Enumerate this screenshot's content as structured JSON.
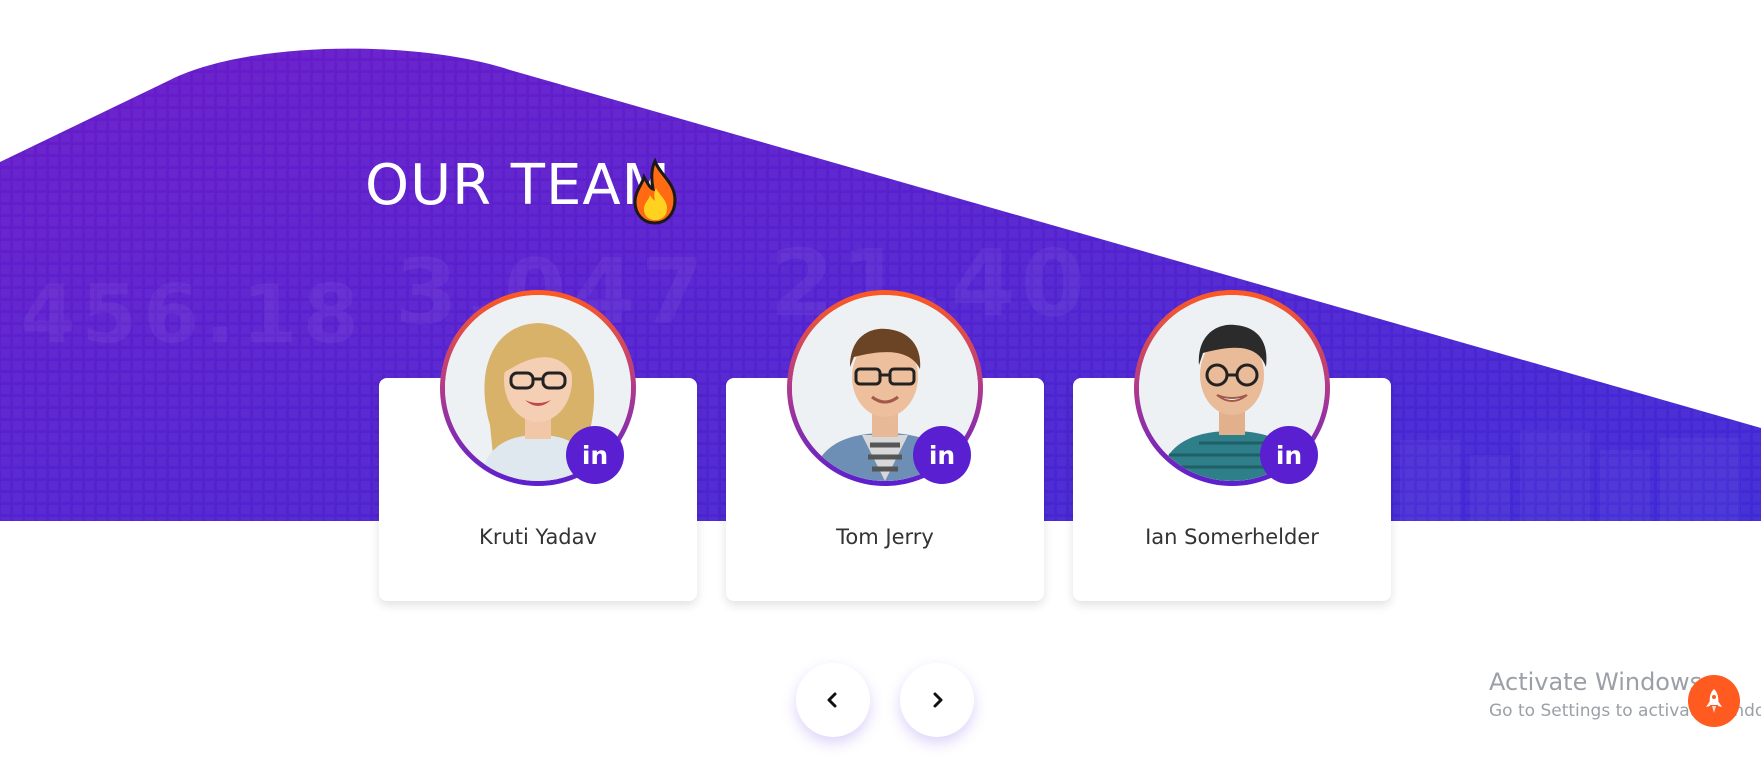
{
  "section": {
    "title": "OUR TEAM"
  },
  "team": [
    {
      "name": "Kruti Yadav",
      "badge": "in"
    },
    {
      "name": "Tom Jerry",
      "badge": "in"
    },
    {
      "name": "Ian Somerhelder",
      "badge": "in"
    }
  ],
  "background_digits": [
    "456.18",
    "3,047",
    "21.40"
  ],
  "carousel": {
    "prev_icon": "chevron-left-icon",
    "next_icon": "chevron-right-icon"
  },
  "watermark": {
    "title": "Activate Windows",
    "subtitle": "Go to Settings to activate Windows."
  },
  "colors": {
    "hero_start": "#6a1bc9",
    "hero_end": "#3f2ad6",
    "accent_orange": "#ff5a1f",
    "badge_purple": "#5a1fd0"
  }
}
